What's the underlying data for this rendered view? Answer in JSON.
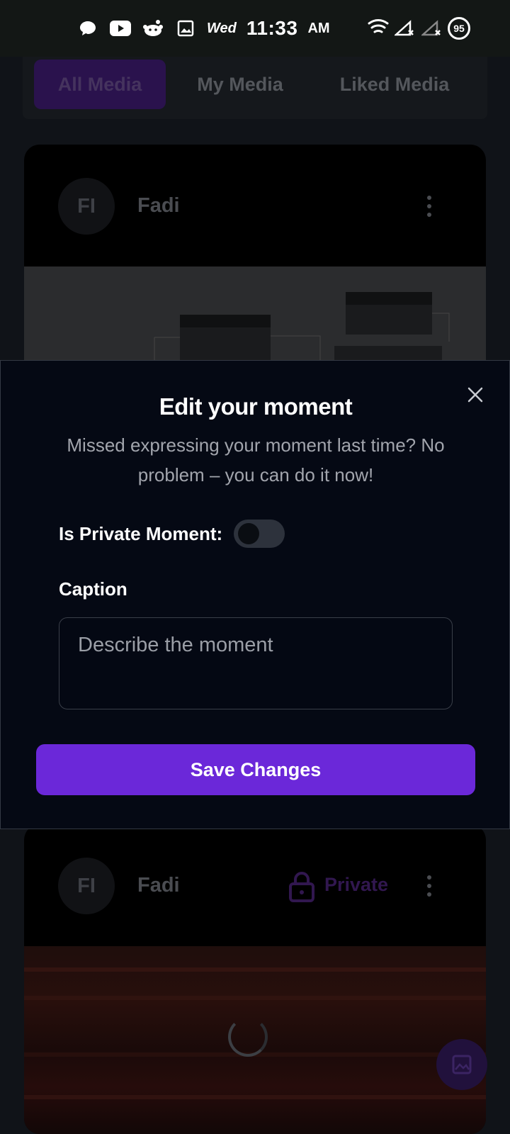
{
  "status_bar": {
    "day": "Wed",
    "time": "11:33",
    "ampm": "AM",
    "battery": "95",
    "icons": [
      "chat-bubble-icon",
      "youtube-icon",
      "reddit-icon",
      "gallery-icon",
      "wifi-icon",
      "signal-icon",
      "signal-icon"
    ]
  },
  "tabs": [
    {
      "label": "All Media",
      "active": true
    },
    {
      "label": "My Media",
      "active": false
    },
    {
      "label": "Liked Media",
      "active": false
    }
  ],
  "posts": [
    {
      "initials": "FI",
      "author": "Fadi"
    },
    {
      "initials": "FI",
      "author": "Fadi",
      "badge": "Private"
    }
  ],
  "modal": {
    "title": "Edit your moment",
    "subtitle": "Missed expressing your moment last time? No problem – you can do it now!",
    "private_label": "Is Private Moment:",
    "private_value": false,
    "caption_label": "Caption",
    "caption_placeholder": "Describe the moment",
    "caption_value": "",
    "save_label": "Save Changes"
  },
  "colors": {
    "accent": "#6b28d9",
    "modal_bg": "#050914",
    "page_bg": "#101318"
  }
}
